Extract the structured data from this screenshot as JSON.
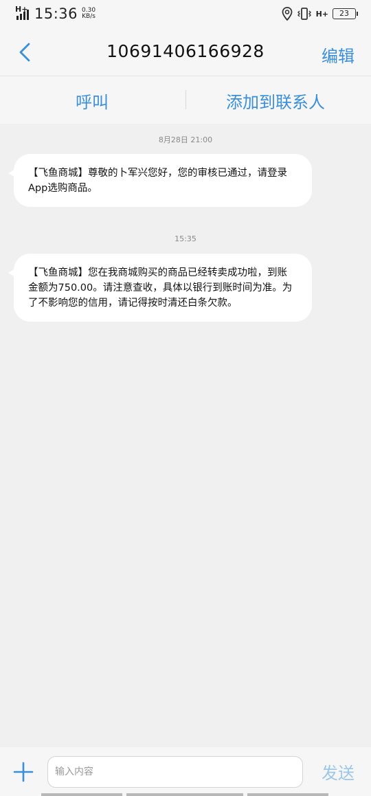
{
  "status_bar": {
    "time": "15:36",
    "net_speed_value": "0.30",
    "net_speed_unit": "KB/s",
    "signal_type": "H+",
    "battery": "23",
    "icons": [
      "signal-icon",
      "location-icon",
      "vibrate-icon",
      "battery-icon"
    ]
  },
  "header": {
    "back_icon": "chevron-left-icon",
    "title": "10691406166928",
    "edit_label": "编辑"
  },
  "actions": {
    "call_label": "呼叫",
    "add_contact_label": "添加到联系人"
  },
  "messages": [
    {
      "timestamp": "8月28日 21:00",
      "lines": [
        "【飞鱼商城】尊敬的卜军兴您好，您的审核已通过，请登录",
        "App选购商品。"
      ]
    },
    {
      "timestamp": "15:35",
      "lines": [
        "【飞鱼商城】您在我商城购买的商品已经转卖成功啦，到账",
        "金额为750.00。请注意查收，具体以银行到账时间为准。为",
        "了不影响您的信用，请记得按时清还白条欠款。"
      ]
    }
  ],
  "composer": {
    "add_icon": "plus-icon",
    "placeholder": "输入内容",
    "send_label": "发送"
  },
  "colors": {
    "accent": "#3a8fd8",
    "send_disabled": "#9cc6ea",
    "background": "#f0f0f0",
    "bar": "#f6f6f6"
  }
}
